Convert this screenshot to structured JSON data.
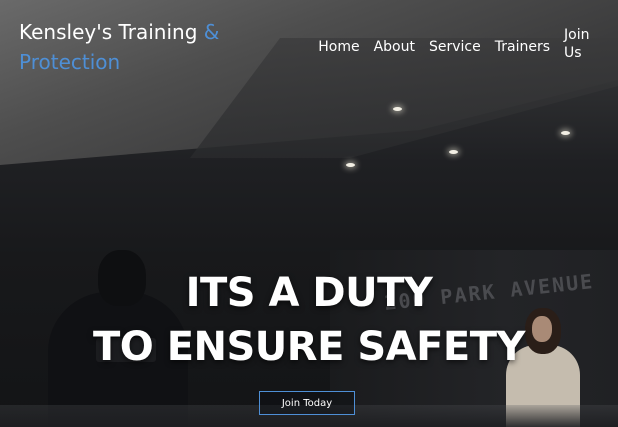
{
  "brand": {
    "name_main": "Kensley's Training",
    "name_amp": "&",
    "name_second": "Protection"
  },
  "nav": {
    "items": [
      "Home",
      "About",
      "Service",
      "Trainers",
      "Join Us"
    ]
  },
  "hero": {
    "line1": "ITS A DUTY",
    "line2": "TO ENSURE SAFETY",
    "cta_label": "Join Today",
    "wall_lettering": "200 PARK AVENUE"
  },
  "colors": {
    "accent": "#4e8fd6",
    "text": "#ffffff",
    "background": "#151619"
  }
}
